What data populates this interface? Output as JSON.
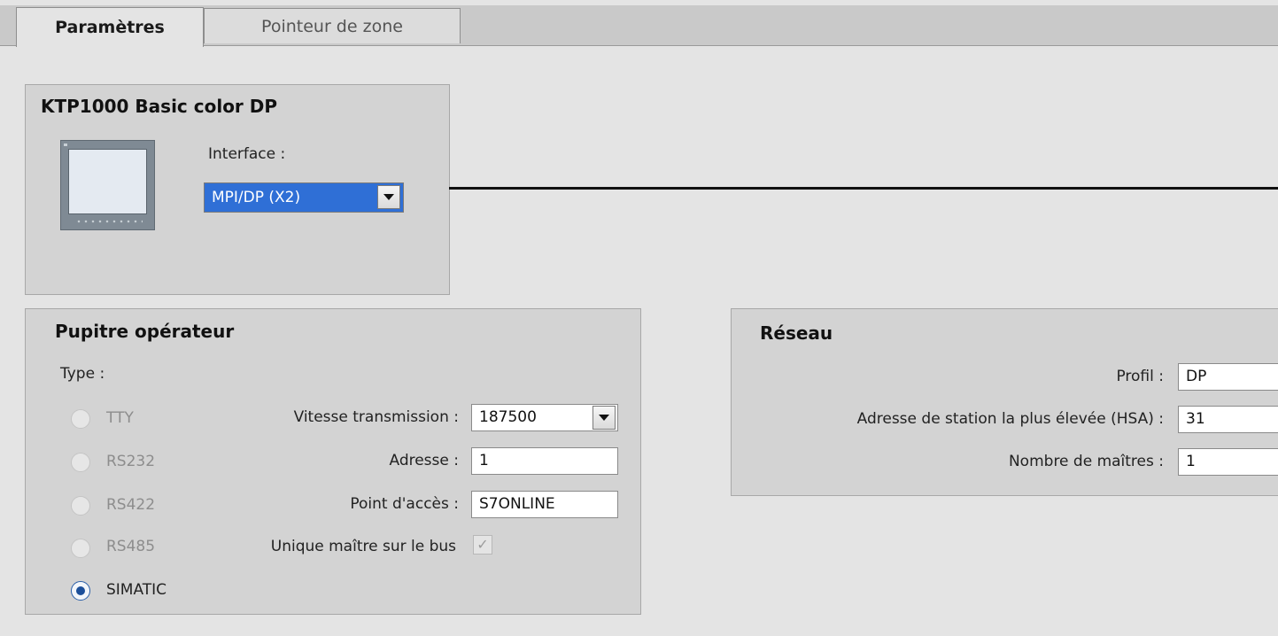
{
  "tabs": [
    {
      "label": "Paramètres",
      "active": true
    },
    {
      "label": "Pointeur de zone",
      "active": false
    }
  ],
  "device": {
    "title": "KTP1000 Basic color DP",
    "interface_label": "Interface :",
    "interface_value": "MPI/DP (X2)",
    "icon": "hmi-panel-icon"
  },
  "operator_panel": {
    "title": "Pupitre opérateur",
    "type_label": "Type :",
    "types": [
      {
        "label": "TTY",
        "checked": false,
        "enabled": false
      },
      {
        "label": "RS232",
        "checked": false,
        "enabled": false
      },
      {
        "label": "RS422",
        "checked": false,
        "enabled": false
      },
      {
        "label": "RS485",
        "checked": false,
        "enabled": false
      },
      {
        "label": "SIMATIC",
        "checked": true,
        "enabled": true
      }
    ],
    "baud_label": "Vitesse transmission :",
    "baud_value": "187500",
    "address_label": "Adresse :",
    "address_value": "1",
    "access_point_label": "Point d'accès :",
    "access_point_value": "S7ONLINE",
    "single_master_label": "Unique maître sur le bus",
    "single_master_checked": true
  },
  "network": {
    "title": "Réseau",
    "profile_label": "Profil :",
    "profile_value": "DP",
    "hsa_label": "Adresse de station la plus élevée (HSA) :",
    "hsa_value": "31",
    "masters_label": "Nombre de maîtres :",
    "masters_value": "1"
  },
  "colors": {
    "selection": "#2f6fd6",
    "panel_bg": "#d3d3d3",
    "page_bg": "#e4e4e4"
  }
}
